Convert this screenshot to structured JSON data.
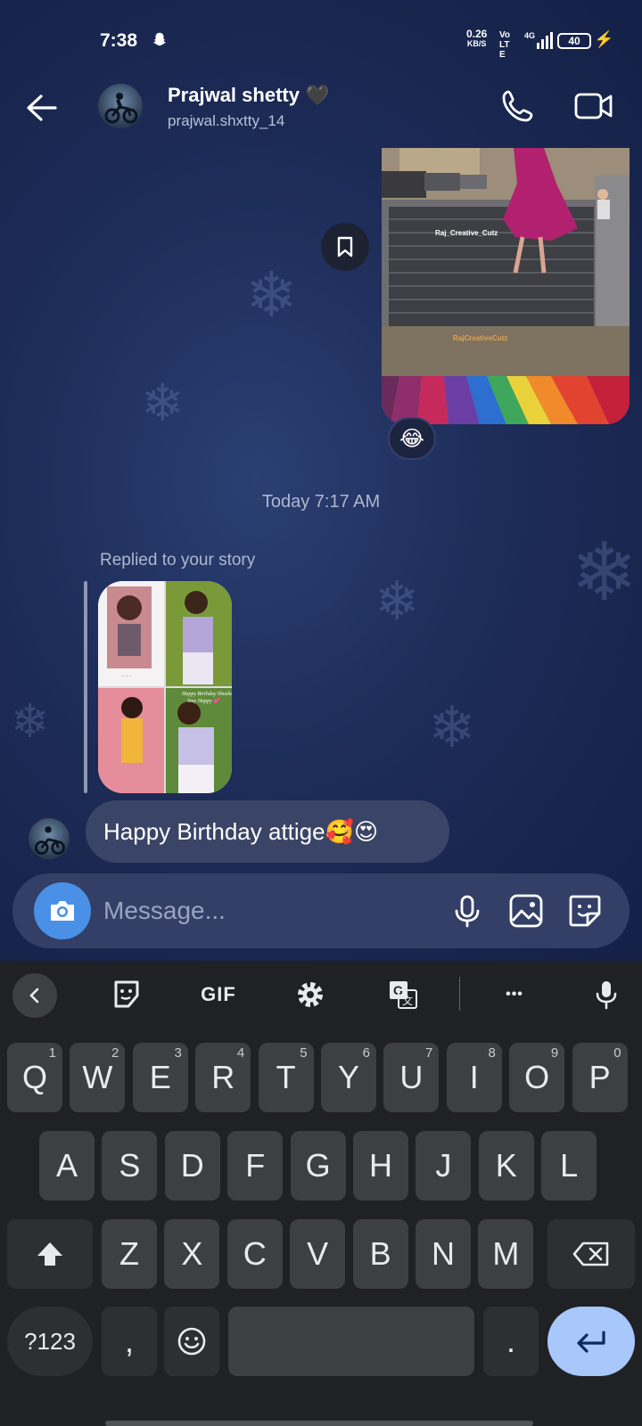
{
  "status_bar": {
    "time": "7:38",
    "net_speed": "0.26",
    "net_unit": "KB/S",
    "volte": "Vo LTE",
    "network": "4G",
    "battery": "40"
  },
  "header": {
    "name": "Prajwal shetty",
    "heart": "🖤",
    "username": "prajwal.shxtty_14"
  },
  "media": {
    "watermark_top": "Raj_Creative_Cutz",
    "watermark_bottom": "RajCreativeCutz",
    "reaction": "😂"
  },
  "thread": {
    "timestamp": "Today 7:17 AM",
    "replied_label": "Replied to your story",
    "story_caption_1": "Happy Birthday Shusha🥰",
    "story_caption_2": "Stay Happy 💕",
    "message_text": "Happy Birthday attige",
    "message_emoji": "🥰😍"
  },
  "composer": {
    "placeholder": "Message..."
  },
  "keyboard": {
    "toolbar": {
      "gif": "GIF",
      "more": "•••"
    },
    "row1": [
      {
        "key": "Q",
        "hint": "1"
      },
      {
        "key": "W",
        "hint": "2"
      },
      {
        "key": "E",
        "hint": "3"
      },
      {
        "key": "R",
        "hint": "4"
      },
      {
        "key": "T",
        "hint": "5"
      },
      {
        "key": "Y",
        "hint": "6"
      },
      {
        "key": "U",
        "hint": "7"
      },
      {
        "key": "I",
        "hint": "8"
      },
      {
        "key": "O",
        "hint": "9"
      },
      {
        "key": "P",
        "hint": "0"
      }
    ],
    "row2": [
      "A",
      "S",
      "D",
      "F",
      "G",
      "H",
      "J",
      "K",
      "L"
    ],
    "row3": [
      "Z",
      "X",
      "C",
      "V",
      "B",
      "N",
      "M"
    ],
    "row4": {
      "sym": "?123",
      "comma": ",",
      "period": "."
    }
  },
  "colors": {
    "accent_blue": "#4a90e6",
    "bubble": "#3a4466",
    "enter_key": "#a8c7fa",
    "keyboard_bg": "#202124"
  }
}
